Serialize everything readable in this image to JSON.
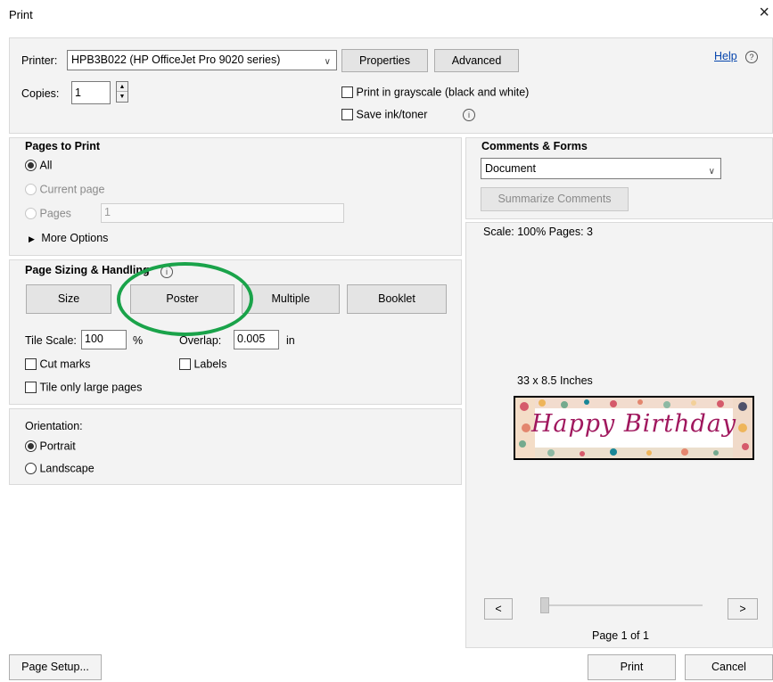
{
  "window": {
    "title": "Print",
    "close_glyph": "×"
  },
  "printer": {
    "label": "Printer:",
    "value": "HPB3B022 (HP OfficeJet Pro 9020 series)",
    "properties_label": "Properties",
    "advanced_label": "Advanced",
    "help_label": "Help",
    "copies_label": "Copies:",
    "copies_value": "1",
    "grayscale_label": "Print in grayscale (black and white)",
    "save_ink_label": "Save ink/toner"
  },
  "pages_to_print": {
    "heading": "Pages to Print",
    "all_label": "All",
    "current_label": "Current page",
    "pages_label": "Pages",
    "pages_value": "1",
    "more_options_label": "More Options"
  },
  "sizing": {
    "heading": "Page Sizing & Handling",
    "buttons": [
      "Size",
      "Poster",
      "Multiple",
      "Booklet"
    ],
    "tile_scale_label": "Tile Scale:",
    "tile_scale_value": "100",
    "percent_label": "%",
    "overlap_label": "Overlap:",
    "overlap_value": "0.005",
    "overlap_unit": "in",
    "cut_marks_label": "Cut marks",
    "labels_label": "Labels",
    "tile_large_label": "Tile only large pages"
  },
  "orientation": {
    "heading": "Orientation:",
    "portrait_label": "Portrait",
    "landscape_label": "Landscape"
  },
  "comments": {
    "heading": "Comments & Forms",
    "value": "Document",
    "summarize_label": "Summarize Comments"
  },
  "preview": {
    "scale_text": "Scale: 100% Pages: 3",
    "size_text": "33 x 8.5 Inches",
    "banner_text": "Happy Birthday",
    "prev_label": "<",
    "next_label": ">",
    "page_text": "Page 1 of 1"
  },
  "footer": {
    "page_setup_label": "Page Setup...",
    "print_label": "Print",
    "cancel_label": "Cancel"
  },
  "colors": {
    "highlight_circle": "#1aa34a",
    "banner_text": "#a0185e"
  }
}
